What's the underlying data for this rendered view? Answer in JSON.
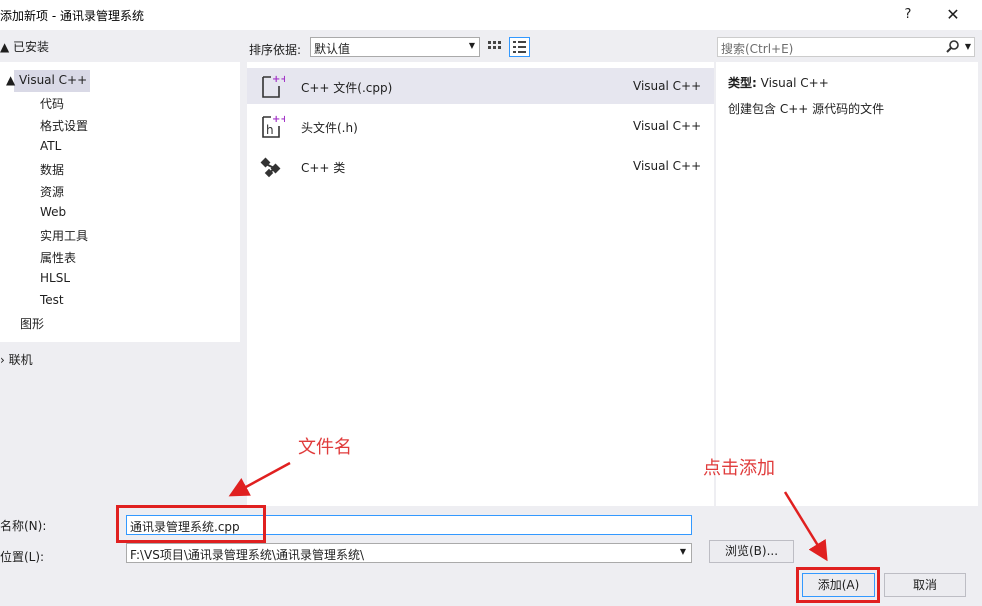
{
  "dialog": {
    "title": "添加新项 - 通讯录管理系统",
    "help": "?",
    "close": "✕"
  },
  "left": {
    "installed": "▲ 已安装",
    "tree": [
      {
        "label": "▲ Visual C++",
        "selected": true
      },
      {
        "label": "代码"
      },
      {
        "label": "格式设置"
      },
      {
        "label": "ATL"
      },
      {
        "label": "数据"
      },
      {
        "label": "资源"
      },
      {
        "label": "Web"
      },
      {
        "label": "实用工具"
      },
      {
        "label": "属性表"
      },
      {
        "label": "HLSL"
      },
      {
        "label": "Test"
      },
      {
        "label": "图形"
      }
    ],
    "online": "› 联机"
  },
  "toolbar": {
    "sort_label": "排序依据:",
    "sort_value": "默认值"
  },
  "templates": [
    {
      "name": "C++ 文件(.cpp)",
      "lang": "Visual C++",
      "icon": "cpp-file-icon",
      "selected": true
    },
    {
      "name": "头文件(.h)",
      "lang": "Visual C++",
      "icon": "header-file-icon"
    },
    {
      "name": "C++ 类",
      "lang": "Visual C++",
      "icon": "class-icon"
    }
  ],
  "search": {
    "placeholder": "搜索(Ctrl+E)"
  },
  "details": {
    "type_label": "类型:",
    "type_value": "Visual C++",
    "description": "创建包含 C++ 源代码的文件"
  },
  "form": {
    "name_label": "名称(N):",
    "name_value": "通讯录管理系统.cpp",
    "location_label": "位置(L):",
    "location_value": "F:\\VS项目\\通讯录管理系统\\通讯录管理系统\\"
  },
  "buttons": {
    "browse": "浏览(B)...",
    "add": "添加(A)",
    "cancel": "取消"
  },
  "annotations": {
    "filename": "文件名",
    "click_add": "点击添加"
  },
  "colors": {
    "accent": "#3399ff",
    "annotation": "#e02020"
  }
}
